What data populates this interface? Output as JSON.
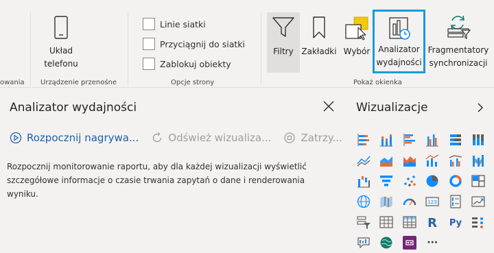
{
  "ribbon": {
    "groups": {
      "partial": "owania",
      "mobile": "Urządzenie przenośne",
      "page_options": "Opcje strony",
      "show_panes": "Pokaż okienka"
    },
    "phone_layout": {
      "line1": "Układ",
      "line2": "telefonu"
    },
    "checkboxes": [
      {
        "label": "Linie siatki",
        "checked": false
      },
      {
        "label": "Przyciągnij do siatki",
        "checked": false
      },
      {
        "label": "Zablokuj obiekty",
        "checked": false
      }
    ],
    "filters_label": "Filtry",
    "bookmarks_label": "Zakładki",
    "selection_label": "Wybór",
    "perf_analyzer": {
      "line1": "Analizator",
      "line2": "wydajności"
    },
    "sync_slicers": {
      "line1": "Fragmentatory",
      "line2": "synchronizacji"
    }
  },
  "perf_pane": {
    "title": "Analizator wydajności",
    "start_recording": "Rozpocznij nagrywa...",
    "refresh_visuals": "Odśwież wizualiza...",
    "stop": "Zatrzy...",
    "description": "Rozpocznij monitorowanie raportu, aby dla każdej wizualizacji wyświetlić szczegółowe informacje o czasie trwania zapytań o dane i renderowania wyniku."
  },
  "viz_pane": {
    "title": "Wizualizacje",
    "more": "···",
    "r_label": "R",
    "py_label": "Py",
    "card_label": "123"
  },
  "colors": {
    "accent_blue": "#118dff",
    "selected_outline": "#1a9bd7",
    "orange": "#e66c37",
    "teal": "#107c6c",
    "active_bg": "#e1dfdd"
  }
}
